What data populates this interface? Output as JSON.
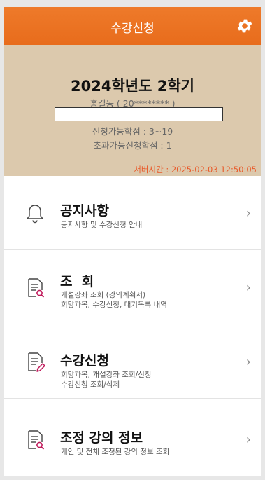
{
  "header": {
    "title": "수강신청",
    "settings_icon": "gear-icon"
  },
  "info": {
    "term": "2024학년도 2학기",
    "student": "홍길동 ( 20******** )",
    "credits_available": "신청가능학점  : 3~19",
    "credits_over": "초과가능신청학점 : 1",
    "server_time": "서버시간 : 2025-02-03 12:50:05"
  },
  "menu": [
    {
      "title": "공지사항",
      "subtitle": "공지사항 및 수강신청 안내",
      "subtitle2": "",
      "icon": "bell-icon"
    },
    {
      "title": "조  회",
      "subtitle": "개설강좌 조회 (강의계획서)",
      "subtitle2": "희망과목, 수강신청, 대기목록 내역",
      "icon": "document-search-icon"
    },
    {
      "title": "수강신청",
      "subtitle": "희망과목, 개설강좌 조회/신청",
      "subtitle2": "수강신청 조회/삭제",
      "icon": "document-edit-icon"
    },
    {
      "title": "조정 강의 정보",
      "subtitle": "개인 및 전체 조정된 강의 정보 조회",
      "subtitle2": "",
      "icon": "document-search-icon"
    }
  ],
  "chevron": "›",
  "colors": {
    "header": "#e8701f",
    "info_bg": "#dcc9ad",
    "server_time": "#e85a2a"
  }
}
